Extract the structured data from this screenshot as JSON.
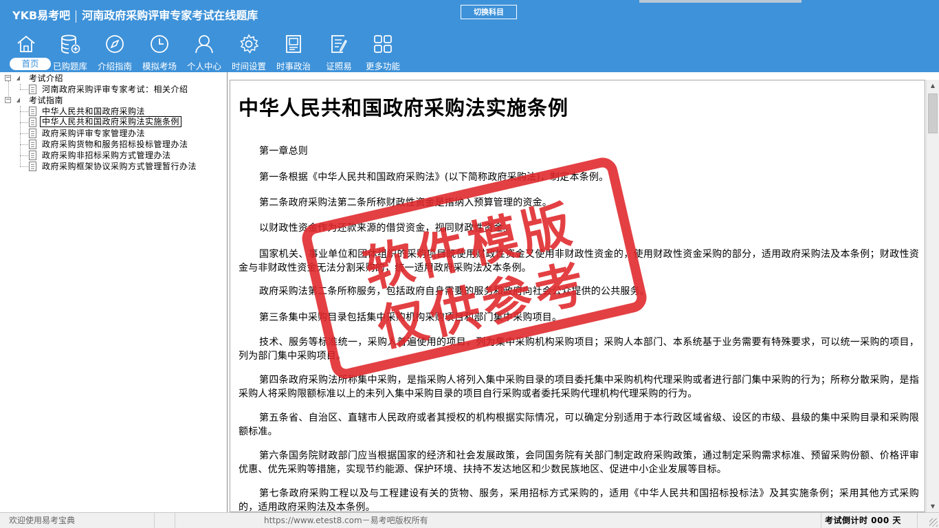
{
  "header": {
    "logo": "YKB易考吧",
    "app_title": "河南政府采购评审专家考试在线题库",
    "switch_subject": "切换科目",
    "accent_color": "#3e92d9"
  },
  "nav": [
    {
      "label": "首页",
      "icon": "home-icon",
      "active": true
    },
    {
      "label": "已购题库",
      "icon": "database-icon"
    },
    {
      "label": "介绍指南",
      "icon": "compass-icon"
    },
    {
      "label": "模拟考场",
      "icon": "clock-icon"
    },
    {
      "label": "个人中心",
      "icon": "user-icon"
    },
    {
      "label": "时间设置",
      "icon": "gear-icon"
    },
    {
      "label": "时事政治",
      "icon": "book-icon"
    },
    {
      "label": "证照易",
      "icon": "clipboard-icon"
    },
    {
      "label": "更多功能",
      "icon": "grid-icon"
    }
  ],
  "tree": {
    "groups": [
      {
        "label": "考试介绍",
        "items": [
          "河南政府采购评审专家考试：相关介绍"
        ]
      },
      {
        "label": "考试指南",
        "items": [
          "中华人民共和国政府采购法",
          "中华人民共和国政府采购法实施条例",
          "政府采购评审专家管理办法",
          "政府采购货物和服务招标投标管理办法",
          "政府采购非招标采购方式管理办法",
          "政府采购框架协议采购方式管理暂行办法"
        ]
      }
    ],
    "selected": "中华人民共和国政府采购法实施条例"
  },
  "document": {
    "title": "中华人民共和国政府采购法实施条例",
    "paragraphs": [
      "第一章总则",
      "第一条根据《中华人民共和国政府采购法》(以下简称政府采购法)，制定本条例。",
      "第二条政府采购法第二条所称财政性资金是指纳入预算管理的资金。",
      "以财政性资金作为还款来源的借贷资金，视同财政性资金。",
      "国家机关、事业单位和团体组织的采购项目既使用财政性资金又使用非财政性资金的，使用财政性资金采购的部分，适用政府采购法及本条例；财政性资金与非财政性资金无法分割采购的，统一适用政府采购法及本条例。",
      "政府采购法第二条所称服务，包括政府自身需要的服务和政府向社会公众提供的公共服务。",
      "第三条集中采购目录包括集中采购机构采购项目和部门集中采购项目。",
      "技术、服务等标准统一，采购人普遍使用的项目，列为集中采购机构采购项目；采购人本部门、本系统基于业务需要有特殊要求，可以统一采购的项目，列为部门集中采购项目。",
      "第四条政府采购法所称集中采购，是指采购人将列入集中采购目录的项目委托集中采购机构代理采购或者进行部门集中采购的行为；所称分散采购，是指采购人将采购限额标准以上的未列入集中采购目录的项目自行采购或者委托采购代理机构代理采购的行为。",
      "第五条省、自治区、直辖市人民政府或者其授权的机构根据实际情况，可以确定分别适用于本行政区域省级、设区的市级、县级的集中采购目录和采购限额标准。",
      "第六条国务院财政部门应当根据国家的经济和社会发展政策，会同国务院有关部门制定政府采购政策，通过制定采购需求标准、预留采购份额、价格评审优惠、优先采购等措施，实现节约能源、保护环境、扶持不发达地区和少数民族地区、促进中小企业发展等目标。",
      "第七条政府采购工程以及与工程建设有关的货物、服务，采用招标方式采购的，适用《中华人民共和国招标投标法》及其实施条例；采用其他方式采购的，适用政府采购法及本条例。"
    ]
  },
  "watermark": {
    "line1": "软件模版",
    "line2": "仅供参考",
    "color": "#e0262a"
  },
  "status": {
    "welcome": "欢迎使用易考宝典",
    "copyright": "https://www.etest8.com－易考吧版权所有",
    "countdown": "考试倒计时 000 天"
  }
}
